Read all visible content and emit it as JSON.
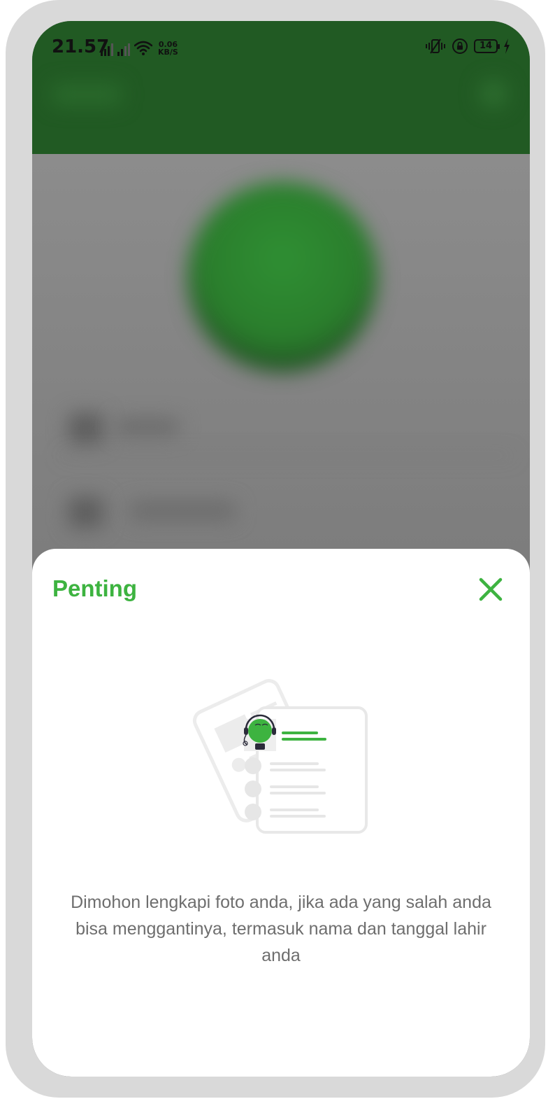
{
  "status_bar": {
    "time": "21.57",
    "net_speed_value": "0.06",
    "net_speed_unit": "KB/S",
    "battery_level": "14",
    "icons": [
      "signal-icon",
      "signal-icon",
      "wifi-icon",
      "vibrate-icon",
      "rotation-lock-icon",
      "battery-icon",
      "charging-icon"
    ]
  },
  "dialog": {
    "title": "Penting",
    "message": "Dimohon lengkapi foto anda, jika ada yang salah anda bisa menggantinya, termasuk nama dan tanggal lahir anda",
    "illustration": "profile-document-illustration",
    "close_icon": "close-icon"
  },
  "colors": {
    "accent": "#3db340",
    "header_bg": "#215a23",
    "message_text": "#6e6e6e",
    "overlay": "#7a7a7a"
  }
}
